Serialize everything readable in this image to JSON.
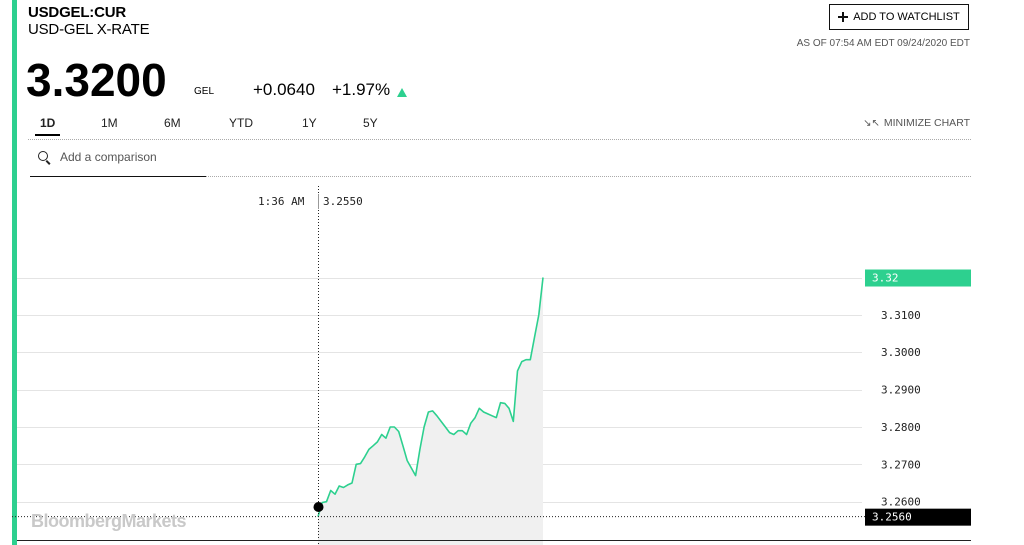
{
  "header": {
    "ticker": "USDGEL:CUR",
    "name": "USD-GEL X-RATE",
    "price": "3.3200",
    "currency": "GEL",
    "change": "+0.0640",
    "change_pct": "+1.97%",
    "watchlist_label": "ADD TO WATCHLIST",
    "as_of": "AS OF 07:54 AM EDT 09/24/2020 EDT"
  },
  "tabs": [
    {
      "label": "1D",
      "active": true
    },
    {
      "label": "1M"
    },
    {
      "label": "6M"
    },
    {
      "label": "YTD"
    },
    {
      "label": "1Y"
    },
    {
      "label": "5Y"
    }
  ],
  "minimize_label": "MINIMIZE CHART",
  "search": {
    "placeholder": "Add a comparison"
  },
  "logo": "BloombergMarkets",
  "colors": {
    "accent": "#2dd08f",
    "up": "#2dd08f",
    "fill": "#f0f0f0"
  },
  "chart_data": {
    "type": "area",
    "ylim": [
      3.2535,
      3.3287
    ],
    "yticks": [
      "3.2600",
      "3.2700",
      "3.2800",
      "3.2900",
      "3.3000",
      "3.3100"
    ],
    "current_value_label": "3.32",
    "reference_value_label": "3.2560",
    "crosshair": {
      "time": "1:36 AM",
      "value": "3.2550"
    },
    "series": [
      {
        "values": [
          3.256,
          3.2598,
          3.26,
          3.263,
          3.262,
          3.2642,
          3.2638,
          3.2645,
          3.265,
          3.27,
          3.2702,
          3.272,
          3.274,
          3.275,
          3.276,
          3.278,
          3.277,
          3.28,
          3.28,
          3.2788,
          3.275,
          3.271,
          3.269,
          3.267,
          3.274,
          3.28,
          3.284,
          3.2843,
          3.283,
          3.2815,
          3.28,
          3.2785,
          3.278,
          3.279,
          3.279,
          3.278,
          3.281,
          3.2825,
          3.285,
          3.284,
          3.2835,
          3.283,
          3.2825,
          3.2865,
          3.2863,
          3.285,
          3.2815,
          3.295,
          3.2975,
          3.298,
          3.298,
          3.304,
          3.31,
          3.32
        ]
      }
    ]
  }
}
